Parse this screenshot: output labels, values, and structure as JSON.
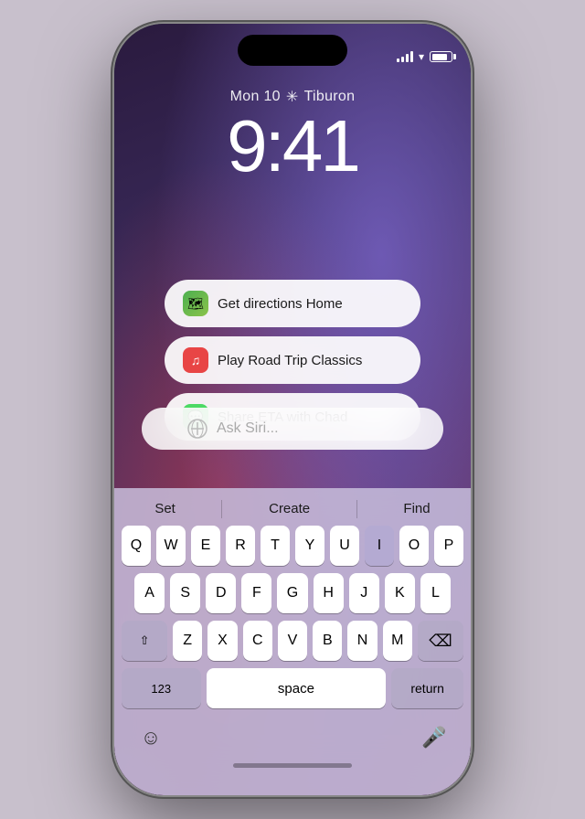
{
  "phone": {
    "status": {
      "date": "Mon 10",
      "weather": "Tiburon",
      "time": "9:41"
    },
    "suggestions": [
      {
        "id": "directions",
        "icon_type": "maps",
        "icon_emoji": "🗺️",
        "label": "Get directions Home"
      },
      {
        "id": "music",
        "icon_type": "music",
        "icon_emoji": "♪",
        "label": "Play Road Trip Classics"
      },
      {
        "id": "messages",
        "icon_type": "messages",
        "icon_emoji": "💬",
        "label": "Share ETA with Chad"
      }
    ],
    "siri_placeholder": "Ask Siri...",
    "quicktype": [
      "Set",
      "Create",
      "Find"
    ],
    "keyboard_rows": [
      [
        "Q",
        "W",
        "E",
        "R",
        "T",
        "Y",
        "U",
        "I",
        "O",
        "P"
      ],
      [
        "A",
        "S",
        "D",
        "F",
        "G",
        "H",
        "J",
        "K",
        "L"
      ],
      [
        "Z",
        "X",
        "C",
        "V",
        "B",
        "N",
        "M"
      ]
    ],
    "special_keys": {
      "shift": "⇧",
      "delete": "⌫",
      "numbers": "123",
      "space": "space",
      "return": "return"
    }
  }
}
